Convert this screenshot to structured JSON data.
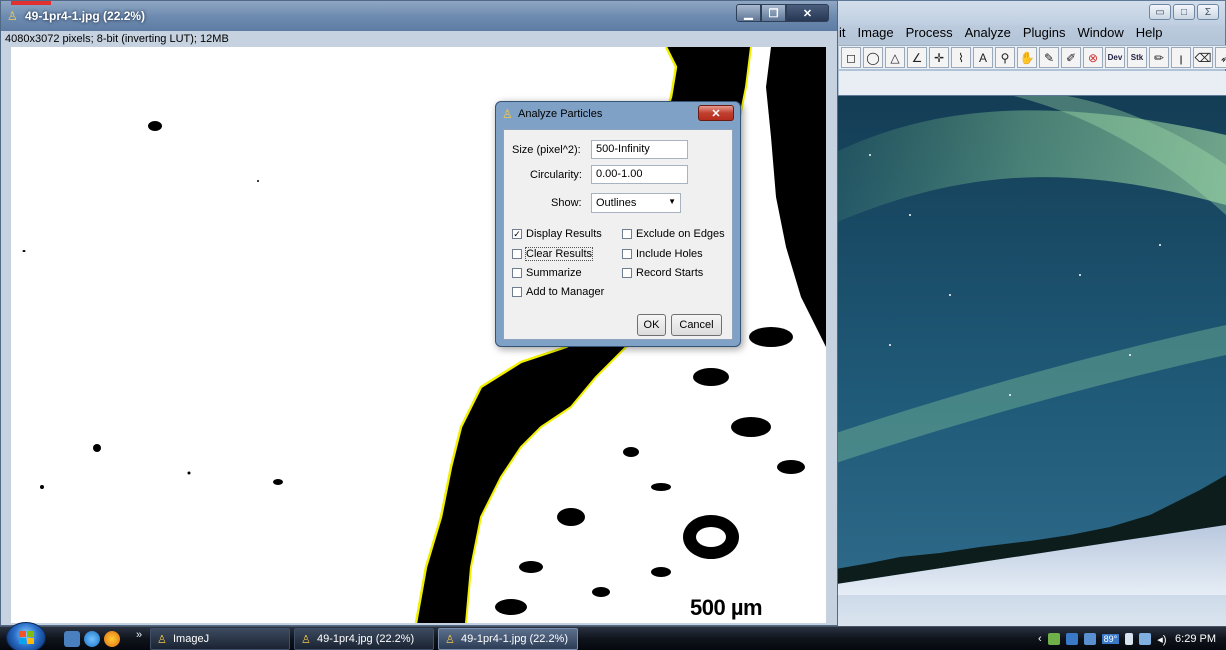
{
  "image_window": {
    "title": "49-1pr4-1.jpg (22.2%)",
    "info": "4080x3072 pixels; 8-bit (inverting LUT); 12MB",
    "scale_bar_label": "500 µm"
  },
  "imagej_main": {
    "menu": [
      "it",
      "Image",
      "Process",
      "Analyze",
      "Plugins",
      "Window",
      "Help"
    ],
    "tool_icons": [
      "rectangle-icon",
      "oval-icon",
      "polygon-icon",
      "angle-icon",
      "point-icon",
      "wand-icon",
      "text-icon",
      "magnifier-icon",
      "hand-icon",
      "dropper-icon",
      "pencil-icon",
      "stop-icon",
      "dev-icon",
      "stk-icon",
      "brush-icon",
      "flood-fill-icon",
      "eraser-icon",
      "arrow-icon"
    ],
    "tool_glyphs": [
      "◻",
      "◯",
      "△",
      "∠",
      "✛",
      "⌇",
      "A",
      "⚲",
      "✋",
      "✎",
      "✐",
      "⊗",
      "Dev",
      "Stk",
      "✏",
      "ꞁ",
      "⌫",
      "➶"
    ],
    "overflow": "»"
  },
  "dialog": {
    "title": "Analyze Particles",
    "size_label": "Size (pixel^2):",
    "size_value": "500-Infinity",
    "circularity_label": "Circularity:",
    "circularity_value": "0.00-1.00",
    "show_label": "Show:",
    "show_value": "Outlines",
    "checkboxes": {
      "display_results": {
        "label": "Display Results",
        "checked": true
      },
      "clear_results": {
        "label": "Clear Results",
        "checked": false
      },
      "summarize": {
        "label": "Summarize",
        "checked": false
      },
      "add_to_manager": {
        "label": "Add to Manager",
        "checked": false
      },
      "exclude_edges": {
        "label": "Exclude on Edges",
        "checked": false
      },
      "include_holes": {
        "label": "Include Holes",
        "checked": false
      },
      "record_starts": {
        "label": "Record Starts",
        "checked": false
      }
    },
    "ok_label": "OK",
    "cancel_label": "Cancel"
  },
  "taskbar": {
    "quick_launch_more": "»",
    "tasks": [
      {
        "label": "ImageJ"
      },
      {
        "label": "49-1pr4.jpg (22.2%)"
      },
      {
        "label": "49-1pr4-1.jpg (22.2%)"
      }
    ],
    "temperature": "89°",
    "clock": "6:29 PM"
  },
  "colors": {
    "outline_yellow": "#f0f000",
    "dialog_frame": "#7fa1c6",
    "taskbar": "#0f141c"
  }
}
